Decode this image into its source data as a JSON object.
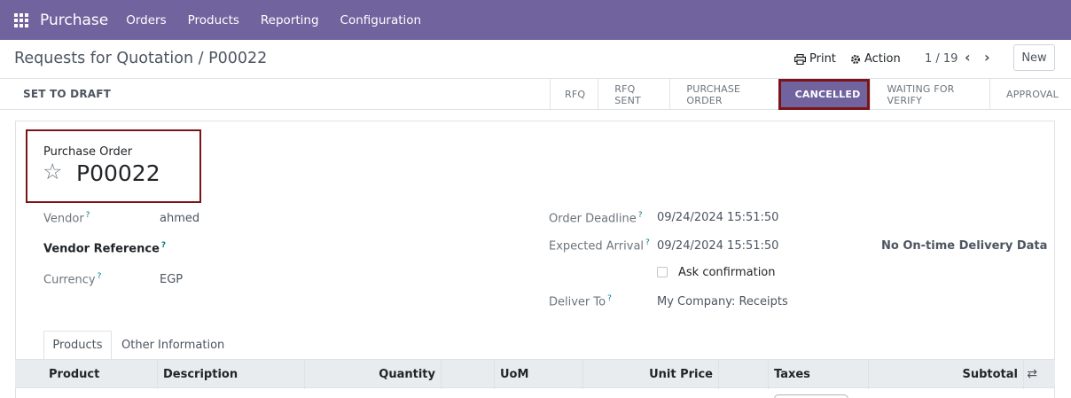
{
  "nav": {
    "app_name": "Purchase",
    "items": [
      "Orders",
      "Products",
      "Reporting",
      "Configuration"
    ]
  },
  "control": {
    "breadcrumb": "Requests for Quotation / P00022",
    "print_label": "Print",
    "action_label": "Action",
    "pager": "1 / 19",
    "new_label": "New"
  },
  "statusbar": {
    "set_draft_label": "SET TO DRAFT",
    "stages": [
      "RFQ",
      "RFQ SENT",
      "PURCHASE ORDER",
      "CANCELLED",
      "WAITING FOR VERIFY",
      "APPROVAL"
    ],
    "active_stage": "CANCELLED"
  },
  "form": {
    "doc_type": "Purchase Order",
    "name": "P00022",
    "vendor_label": "Vendor",
    "vendor_value": "ahmed",
    "vendor_ref_label": "Vendor Reference",
    "currency_label": "Currency",
    "currency_value": "EGP",
    "deadline_label": "Order Deadline",
    "deadline_value": "09/24/2024 15:51:50",
    "arrival_label": "Expected Arrival",
    "arrival_value": "09/24/2024 15:51:50",
    "ontime_label": "No On-time Delivery Data",
    "ask_confirmation_label": "Ask confirmation",
    "deliver_to_label": "Deliver To",
    "deliver_to_value": "My Company: Receipts",
    "help_mark": "?"
  },
  "tabs": {
    "products": "Products",
    "other": "Other Information"
  },
  "table": {
    "headers": {
      "product": "Product",
      "description": "Description",
      "quantity": "Quantity",
      "uom": "UoM",
      "unit_price": "Unit Price",
      "taxes": "Taxes",
      "subtotal": "Subtotal"
    }
  },
  "colors": {
    "brand": "#71639e",
    "highlight_border": "#7b1416"
  }
}
